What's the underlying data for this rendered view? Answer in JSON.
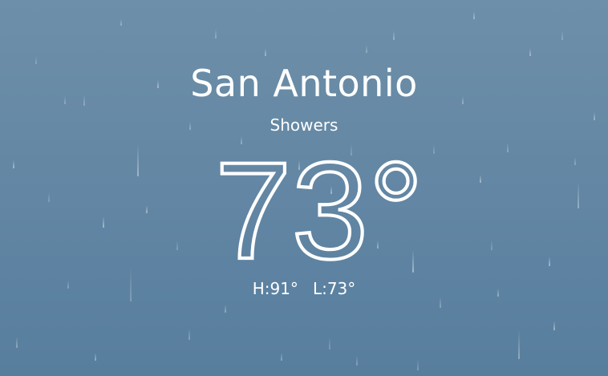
{
  "weather": {
    "location": "San Antonio",
    "condition": "Showers",
    "temperature": "73°",
    "high": "H:91°",
    "low": "L:73°"
  },
  "theme": {
    "text_color": "#ffffff",
    "background_top": "#6e8fa9",
    "background_bottom": "#587e9e",
    "effect": "rain"
  }
}
